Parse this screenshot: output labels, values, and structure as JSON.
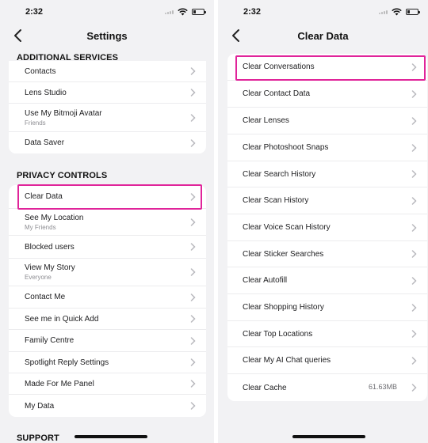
{
  "left": {
    "status": {
      "time": "2:32"
    },
    "title": "Settings",
    "sections": {
      "additional": "ADDITIONAL SERVICES",
      "privacy": "PRIVACY CONTROLS",
      "support": "SUPPORT"
    },
    "additional_items": [
      {
        "label": "Contacts"
      },
      {
        "label": "Lens Studio"
      },
      {
        "label": "Use My Bitmoji Avatar",
        "sub": "Friends"
      },
      {
        "label": "Data Saver"
      }
    ],
    "privacy_items": [
      {
        "label": "Clear Data"
      },
      {
        "label": "See My Location",
        "sub": "My Friends"
      },
      {
        "label": "Blocked users"
      },
      {
        "label": "View My Story",
        "sub": "Everyone"
      },
      {
        "label": "Contact Me"
      },
      {
        "label": "See me in Quick Add"
      },
      {
        "label": "Family Centre"
      },
      {
        "label": "Spotlight Reply Settings"
      },
      {
        "label": "Made For Me Panel"
      },
      {
        "label": "My Data"
      }
    ]
  },
  "right": {
    "status": {
      "time": "2:32"
    },
    "title": "Clear Data",
    "items": [
      {
        "label": "Clear Conversations"
      },
      {
        "label": "Clear Contact Data"
      },
      {
        "label": "Clear Lenses"
      },
      {
        "label": "Clear Photoshoot Snaps"
      },
      {
        "label": "Clear Search History"
      },
      {
        "label": "Clear Scan History"
      },
      {
        "label": "Clear Voice Scan History"
      },
      {
        "label": "Clear Sticker Searches"
      },
      {
        "label": "Clear Autofill"
      },
      {
        "label": "Clear Shopping History"
      },
      {
        "label": "Clear Top Locations"
      },
      {
        "label": "Clear My AI Chat queries"
      },
      {
        "label": "Clear Cache",
        "value": "61.63MB"
      }
    ]
  },
  "colors": {
    "highlight": "#e0249a",
    "background": "#f2f2f4",
    "card": "#ffffff"
  }
}
